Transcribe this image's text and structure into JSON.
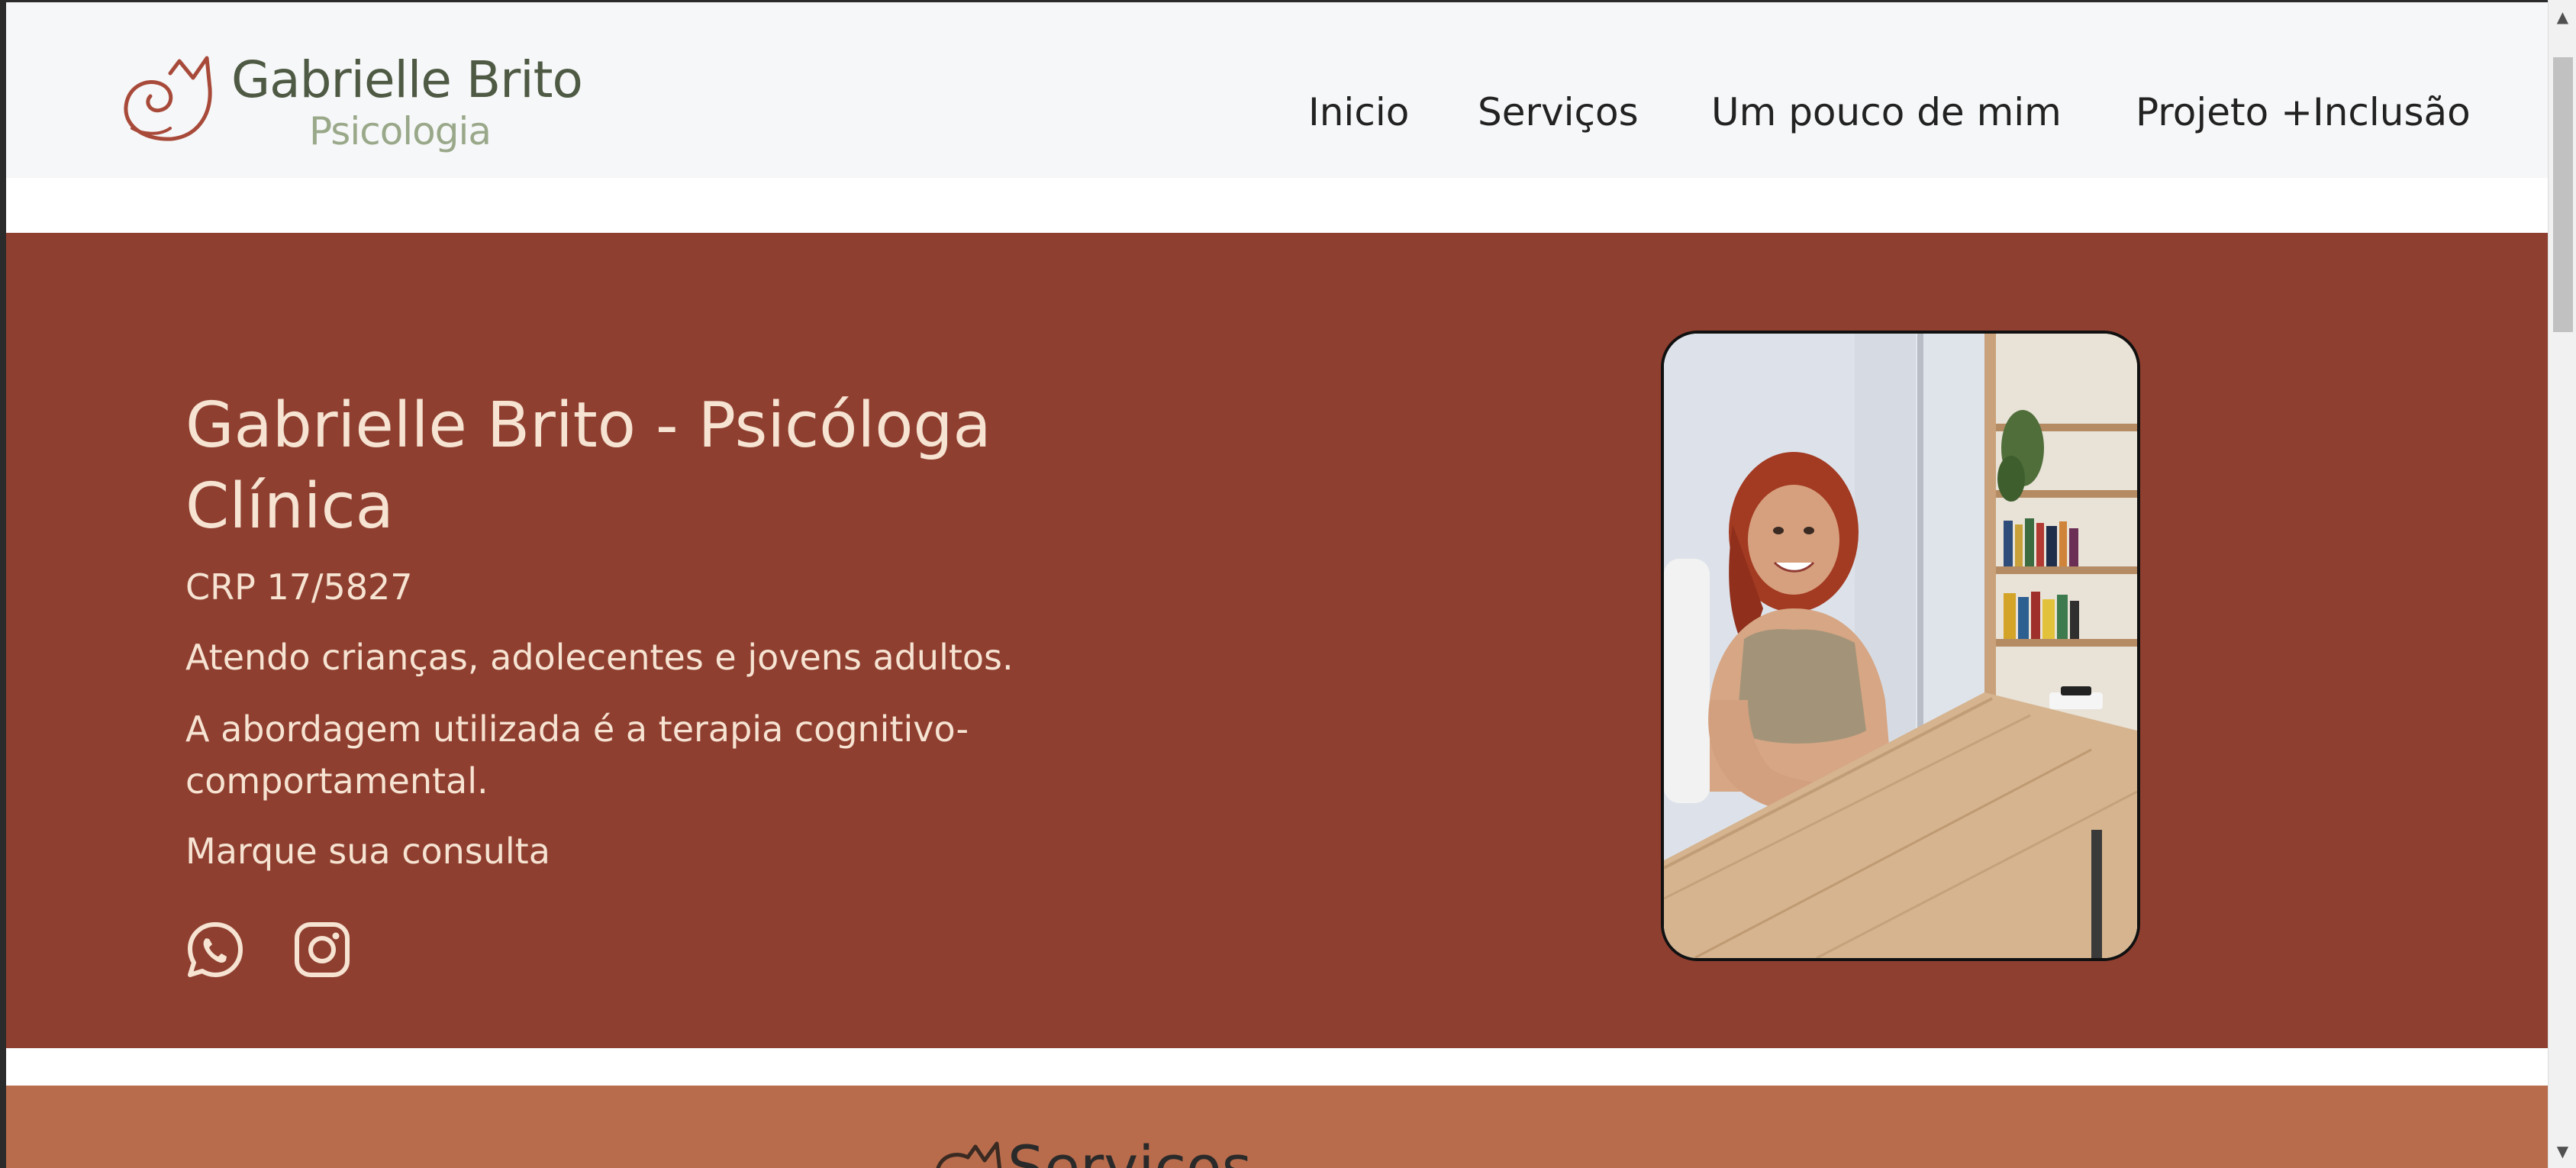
{
  "logo": {
    "name": "Gabrielle Brito",
    "subtitle": "Psicologia"
  },
  "nav": {
    "items": [
      {
        "label": "Inicio"
      },
      {
        "label": "Serviços"
      },
      {
        "label": "Um pouco de mim"
      },
      {
        "label": "Projeto +Inclusão"
      }
    ]
  },
  "hero": {
    "title": "Gabrielle Brito - Psicóloga Clínica",
    "crp": "CRP 17/5827",
    "line1": "Atendo crianças, adolecentes e jovens adultos.",
    "line2": "A abordagem utilizada é a terapia cognitivo-comportamental.",
    "cta": "Marque sua consulta",
    "social": [
      {
        "icon": "whatsapp-icon"
      },
      {
        "icon": "instagram-icon"
      }
    ]
  },
  "services": {
    "title": "Serviços"
  },
  "colors": {
    "header_bg": "#f6f7f8",
    "hero_bg": "#8f3f30",
    "hero_text": "#f6e3d2",
    "services_bg": "#b86c4c",
    "logo_primary": "#4f5a45",
    "logo_secondary": "#9aa88a",
    "logo_mark": "#a84a3a"
  }
}
